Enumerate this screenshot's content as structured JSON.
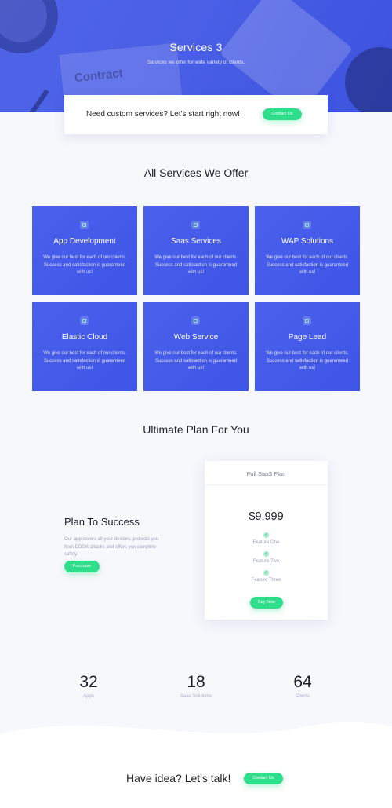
{
  "hero": {
    "title": "Services 3",
    "subtitle": "Services we offer for wide variety of clients.",
    "image_text": "Contract"
  },
  "cta": {
    "text": "Need custom services? Let's start right now!",
    "button": "Contact Us"
  },
  "services": {
    "title": "All Services We Offer",
    "items": [
      {
        "icon": "layers-icon",
        "title": "App Development",
        "desc": "We give our best for each of our clients. Success and satisfaction is guaranteed with us!"
      },
      {
        "icon": "monitor-icon",
        "title": "Saas Services",
        "desc": "We give our best for each of our clients. Success and satisfaction is guaranteed with us!"
      },
      {
        "icon": "globe-icon",
        "title": "WAP Solutions",
        "desc": "We give our best for each of our clients. Success and satisfaction is guaranteed with us!"
      },
      {
        "icon": "cloud-icon",
        "title": "Elastic Cloud",
        "desc": "We give our best for each of our clients. Success and satisfaction is guaranteed with us!"
      },
      {
        "icon": "web-icon",
        "title": "Web Service",
        "desc": "We give our best for each of our clients. Success and satisfaction is guaranteed with us!"
      },
      {
        "icon": "document-icon",
        "title": "Page Lead",
        "desc": "We give our best for each of our clients. Success and satisfaction is guaranteed with us!"
      }
    ]
  },
  "plan": {
    "section_title": "Ultimate Plan For You",
    "heading": "Plan To Success",
    "description": "Our app covers all your devices, protects you from DDOS attacks and offers you complete safety.",
    "purchase_button": "Purchase",
    "card": {
      "name": "Full SaaS Plan",
      "price": "$9,999",
      "features": [
        "Feature One",
        "Feature Two",
        "Feature Three"
      ],
      "button": "Buy Now"
    }
  },
  "stats": [
    {
      "value": "32",
      "label": "Apps"
    },
    {
      "value": "18",
      "label": "Saas Solutions"
    },
    {
      "value": "64",
      "label": "Clients"
    }
  ],
  "footer": {
    "text": "Have idea? Let's talk!",
    "button": "Contact Us"
  },
  "colors": {
    "primary": "#4b60ec",
    "accent": "#2fde8a",
    "background": "#f7f8fc"
  }
}
